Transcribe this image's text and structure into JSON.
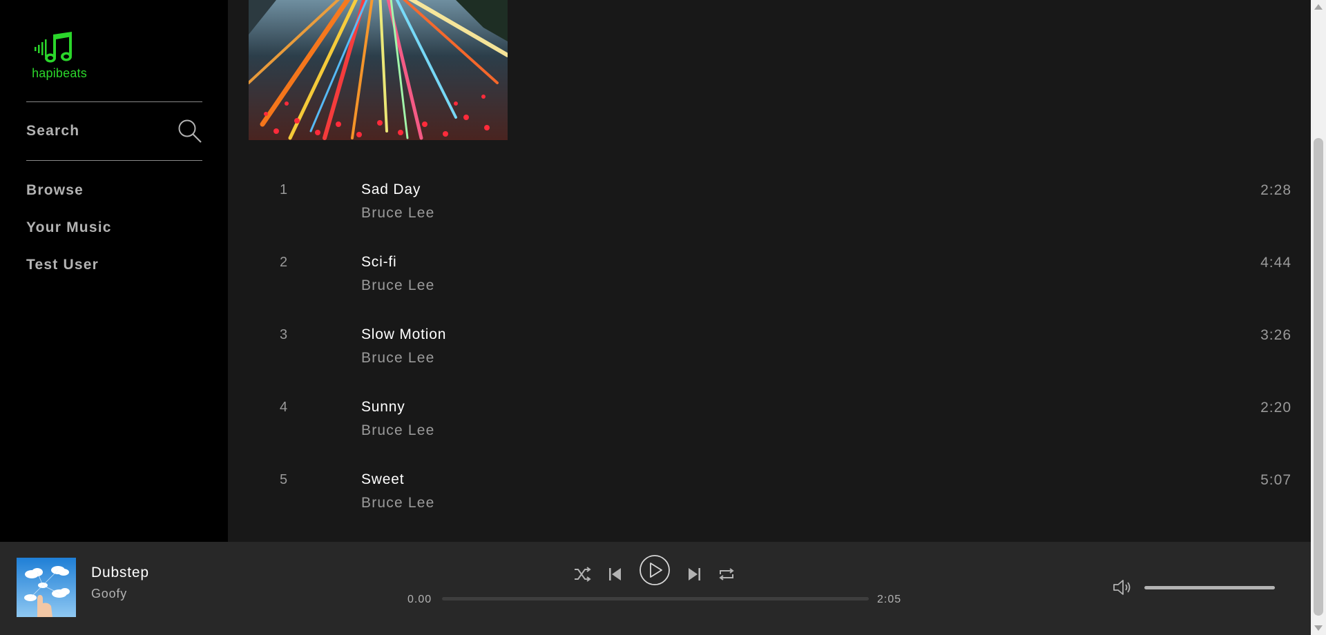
{
  "sidebar": {
    "logo_text": "hapibeats",
    "search_label": "Search",
    "nav": [
      {
        "label": "Browse"
      },
      {
        "label": "Your Music"
      },
      {
        "label": "Test User"
      }
    ]
  },
  "tracks": [
    {
      "number": "1",
      "title": "Sad Day",
      "artist": "Bruce Lee",
      "duration": "2:28"
    },
    {
      "number": "2",
      "title": "Sci-fi",
      "artist": "Bruce Lee",
      "duration": "4:44"
    },
    {
      "number": "3",
      "title": "Slow Motion",
      "artist": "Bruce Lee",
      "duration": "3:26"
    },
    {
      "number": "4",
      "title": "Sunny",
      "artist": "Bruce Lee",
      "duration": "2:20"
    },
    {
      "number": "5",
      "title": "Sweet",
      "artist": "Bruce Lee",
      "duration": "5:07"
    }
  ],
  "player": {
    "title": "Dubstep",
    "artist": "Goofy",
    "current_time": "0.00",
    "total_time": "2:05",
    "progress_fraction": 0,
    "volume_fraction": 1
  },
  "colors": {
    "accent": "#2bd62b",
    "sidebar_bg": "#000000",
    "main_bg": "#181818",
    "player_bg": "#282828"
  },
  "icons": [
    "music-note-logo-icon",
    "search-icon",
    "shuffle-icon",
    "previous-icon",
    "play-icon",
    "next-icon",
    "repeat-icon",
    "volume-icon"
  ]
}
